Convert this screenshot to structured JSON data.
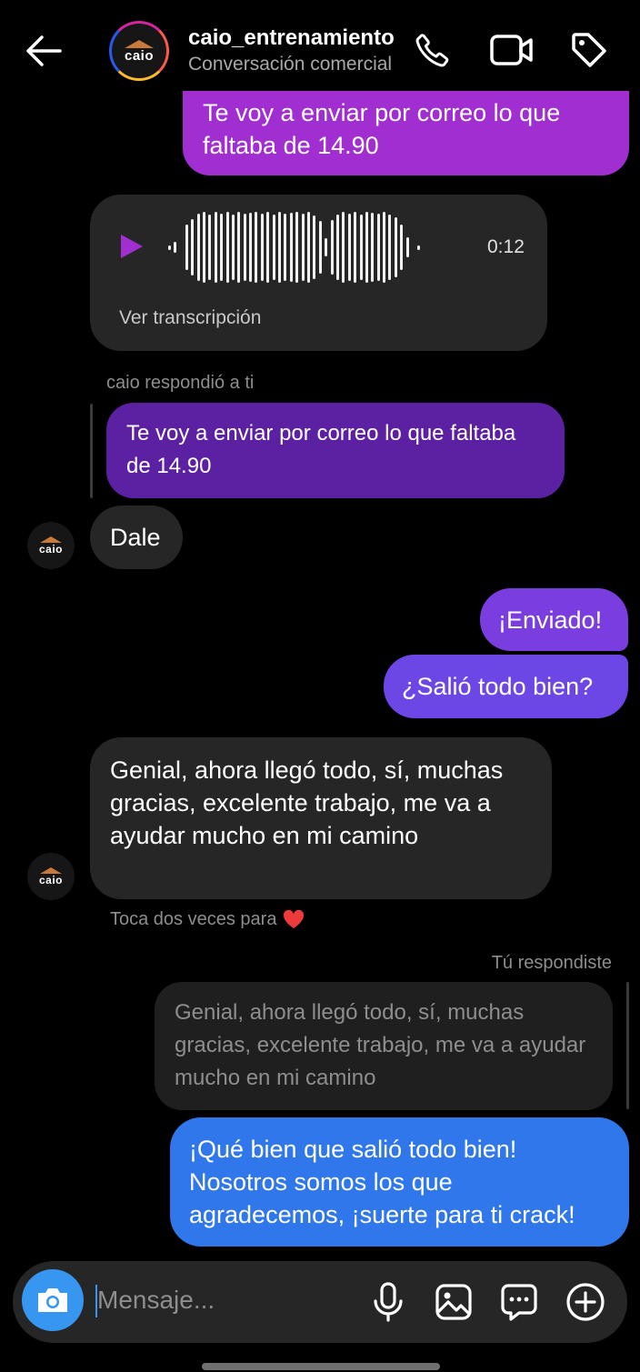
{
  "header": {
    "username": "caio_entrenamiento",
    "subtitle": "Conversación comercial",
    "avatar_text": "caio"
  },
  "messages": {
    "m1_text": "Te voy a enviar por correo lo que faltaba de 14.90",
    "audio_duration": "0:12",
    "audio_transcript_link": "Ver transcripción",
    "reply_meta": "caio respondió a ti",
    "reply_quote": "Te voy a enviar por correo lo que faltaba de 14.90",
    "dale": "Dale",
    "enviado": "¡Enviado!",
    "salio": "¿Salió todo bien?",
    "genial": "Genial, ahora llegó todo, sí, muchas gracias, excelente trabajo, me va a ayudar mucho en mi camino",
    "like_hint": "Toca dos veces para",
    "you_replied": "Tú respondiste",
    "genial_quote": "Genial, ahora llegó todo, sí, muchas gracias, excelente trabajo, me va a ayudar mucho en mi camino",
    "final": "¡Qué bien que salió todo bien! Nosotros somos los que agradecemos, ¡suerte para ti crack!"
  },
  "composer": {
    "placeholder": "Mensaje..."
  },
  "colors": {
    "sent_purple": "#a12ed1",
    "sent_violet": "#7a3ee0",
    "sent_blue": "#2f77ea",
    "received": "#262626",
    "camera_button": "#3797f0"
  },
  "icons": [
    "back-arrow-icon",
    "phone-icon",
    "video-camera-icon",
    "tag-icon",
    "play-icon",
    "heart-icon",
    "camera-icon",
    "microphone-icon",
    "image-icon",
    "sticker-icon",
    "plus-icon"
  ]
}
